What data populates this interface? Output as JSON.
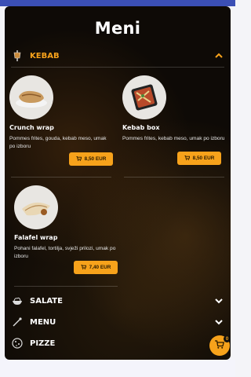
{
  "page": {
    "title": "Meni"
  },
  "colors": {
    "accent": "#f7a21b",
    "topbar": "#3b4fb5",
    "background": "#0e0a06"
  },
  "sections": [
    {
      "label": "KEBAB",
      "icon": "kebab-icon",
      "expanded": true,
      "items": [
        {
          "name": "Crunch wrap",
          "description": "Pommes frites, gouda, kebab meso, umak po izboru",
          "price": "8,50 EUR",
          "icon": "cart-icon"
        },
        {
          "name": "Kebab box",
          "description": "Pommes frites, kebab meso, umak po izboru",
          "price": "8,50 EUR",
          "icon": "cart-icon"
        },
        {
          "name": "Falafel wrap",
          "description": "Pohani falafel, tortilja, svježi prilozi, umak po izboru",
          "price": "7,40 EUR",
          "icon": "cart-icon"
        }
      ]
    },
    {
      "label": "SALATE",
      "icon": "salad-icon",
      "expanded": false
    },
    {
      "label": "MENU",
      "icon": "menu-icon",
      "expanded": false
    },
    {
      "label": "PIZZE",
      "icon": "pizza-icon",
      "expanded": false
    }
  ],
  "cart": {
    "count": "0",
    "icon": "cart-icon"
  }
}
